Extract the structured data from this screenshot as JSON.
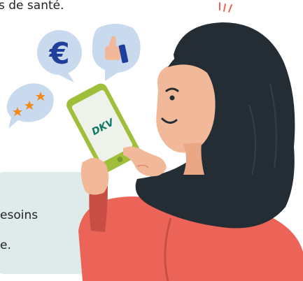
{
  "intro": {
    "text_fragment": "s de santé."
  },
  "info_card": {
    "line_1": "esoins",
    "line_2": "e."
  },
  "phone": {
    "logo_text": "DKV"
  },
  "bubbles": {
    "euro_symbol": "€"
  },
  "colors": {
    "brand_green": "#9fbf3a",
    "dkv_teal": "#0b7a64",
    "euro_blue": "#1f3f9a",
    "bubble_blue": "#c9d9ee",
    "star_orange": "#f08a1c",
    "hair": "#242c34",
    "skin": "#f2b89a",
    "shirt": "#ec6457",
    "card_background": "#dfeaea"
  }
}
